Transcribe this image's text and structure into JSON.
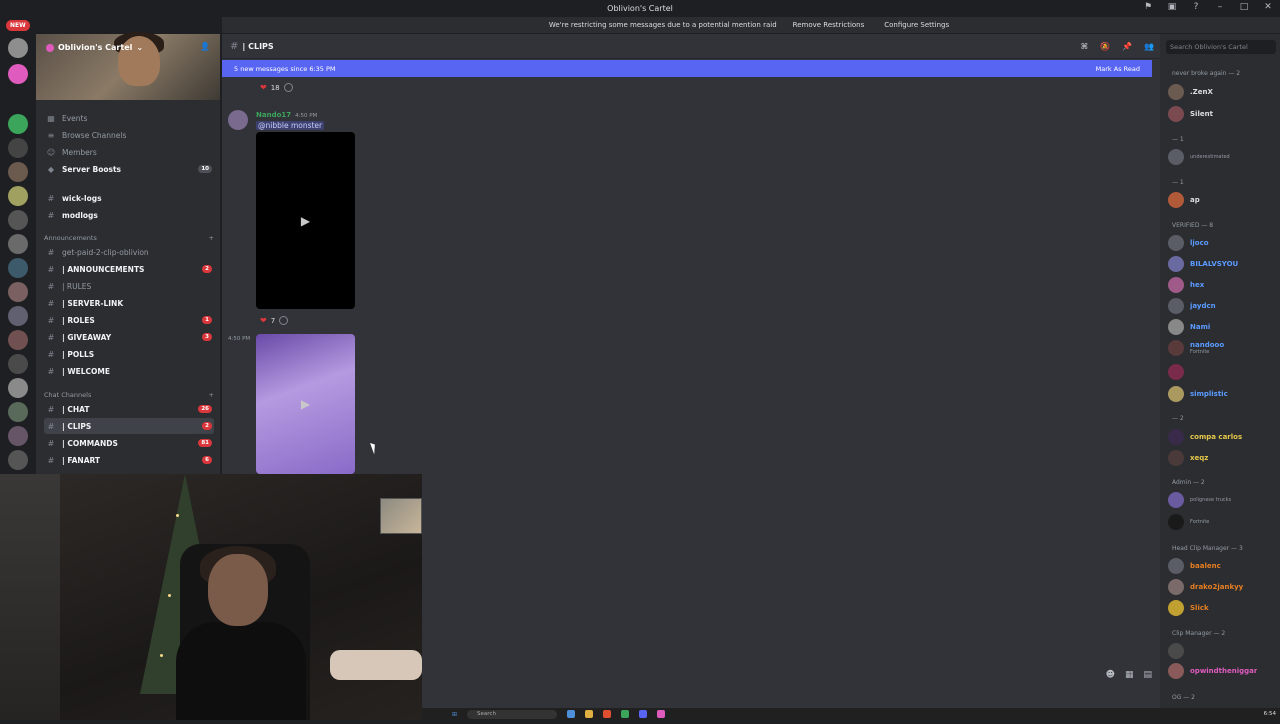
{
  "window": {
    "title": "Oblivion's Cartel",
    "new_badge": "NEW"
  },
  "banner": {
    "text": "We're restricting some messages due to a potential mention raid",
    "remove_label": "Remove Restrictions",
    "configure_label": "Configure Settings"
  },
  "server": {
    "name": "Oblivion's Cartel"
  },
  "sidebar": {
    "top_items": [
      {
        "label": "Events"
      },
      {
        "label": "Browse Channels"
      },
      {
        "label": "Members"
      },
      {
        "label": "Server Boosts",
        "count": "10"
      }
    ],
    "channels_top": [
      {
        "label": "wick-logs"
      },
      {
        "label": "modlogs"
      }
    ],
    "announcements_category": "Announcements",
    "announcements": [
      {
        "label": "get-paid-2-clip-oblivion",
        "count": ""
      },
      {
        "label": "| ANNOUNCEMENTS",
        "count": "2"
      },
      {
        "label": "| RULES",
        "count": ""
      },
      {
        "label": "| SERVER-LINK",
        "count": ""
      },
      {
        "label": "| ROLES",
        "count": "1"
      },
      {
        "label": "| GIVEAWAY",
        "count": "3"
      },
      {
        "label": "| POLLS",
        "count": ""
      },
      {
        "label": "| WELCOME",
        "count": ""
      }
    ],
    "chat_category": "Chat Channels",
    "chat_channels": [
      {
        "label": "| CHAT",
        "count": "26"
      },
      {
        "label": "| CLIPS",
        "count": "2"
      },
      {
        "label": "| COMMANDS",
        "count": "81"
      },
      {
        "label": "| FANART",
        "count": "6"
      }
    ]
  },
  "chat": {
    "channel_name": "| CLIPS",
    "new_messages": "5 new messages since 6:35 PM",
    "mark_read": "Mark As Read",
    "reaction1_count": "18",
    "message": {
      "author": "Nando17",
      "time": "4:50 PM",
      "mention": "@nibble monster"
    },
    "reaction2_count": "7",
    "second_time": "4:50 PM"
  },
  "members": {
    "search_placeholder": "Search Oblivion's Cartel",
    "groups": [
      {
        "label": "never broke again — 2"
      },
      {
        "label": "— 1"
      },
      {
        "label": "— 1"
      },
      {
        "label": "VERIFIED — 8"
      },
      {
        "label": "— 2"
      },
      {
        "label": "Admin — 2"
      },
      {
        "label": "Head Clip Manager — 3"
      },
      {
        "label": "Clip Manager — 2"
      },
      {
        "label": "OG — 2"
      }
    ],
    "list": [
      {
        "name": ".ZenX",
        "sub": "",
        "color": "#dbdee1"
      },
      {
        "name": "Silent",
        "sub": "",
        "color": "#dbdee1"
      },
      {
        "name": "",
        "sub": "underestimated",
        "color": "#dbdee1"
      },
      {
        "name": "ap",
        "sub": "",
        "color": "#dbdee1"
      },
      {
        "name": "ljoco",
        "sub": "",
        "color": "#5b9bff"
      },
      {
        "name": "BILALVSYOU",
        "sub": "",
        "color": "#5b9bff"
      },
      {
        "name": "hex",
        "sub": "",
        "color": "#5b9bff"
      },
      {
        "name": "jaydcn",
        "sub": "",
        "color": "#5b9bff"
      },
      {
        "name": "Nami",
        "sub": "",
        "color": "#5b9bff"
      },
      {
        "name": "nandooo",
        "sub": "Fortnite",
        "color": "#5b9bff"
      },
      {
        "name": "",
        "sub": "",
        "color": "#5b9bff"
      },
      {
        "name": "simplistic",
        "sub": "",
        "color": "#5b9bff"
      },
      {
        "name": "compa carlos",
        "sub": "",
        "color": "#e6c84a"
      },
      {
        "name": "xeqz",
        "sub": "",
        "color": "#e6c84a"
      },
      {
        "name": "",
        "sub": "polignese trucks",
        "color": "#b06ee6"
      },
      {
        "name": "",
        "sub": "Fortnite",
        "color": "#b06ee6"
      },
      {
        "name": "baalenc",
        "sub": "",
        "color": "#e67e22"
      },
      {
        "name": "drako2jankyy",
        "sub": "",
        "color": "#e67e22"
      },
      {
        "name": "Slick",
        "sub": "",
        "color": "#e67e22"
      },
      {
        "name": "",
        "sub": "",
        "color": "#e05bbe"
      },
      {
        "name": "opwindtheniggar",
        "sub": "",
        "color": "#e05bbe"
      }
    ]
  },
  "taskbar": {
    "search_label": "Search",
    "time": "6:54"
  }
}
